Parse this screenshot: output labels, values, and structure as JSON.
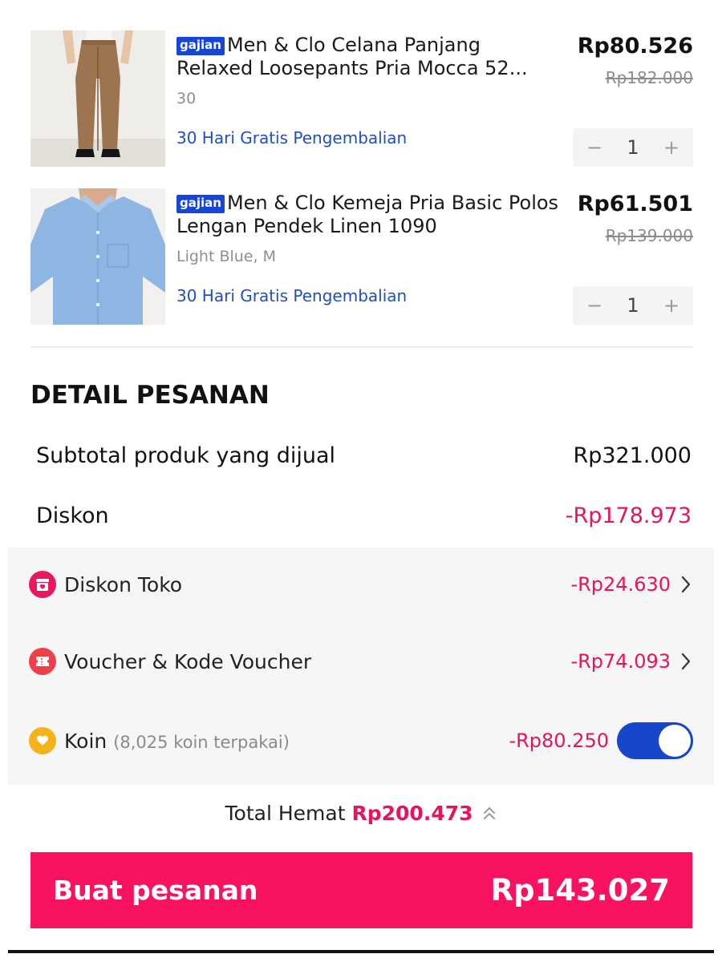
{
  "products": [
    {
      "badge": "gajian",
      "name": "Men & Clo Celana Panjang Relaxed Loosepants Pria Mocca 52...",
      "variant": "30",
      "return_text": "30 Hari Gratis Pengembalian",
      "price": "Rp80.526",
      "old_price": "Rp182.000",
      "qty_minus": "−",
      "qty": "1",
      "qty_plus": "+"
    },
    {
      "badge": "gajian",
      "name": "Men & Clo Kemeja Pria Basic Polos Lengan Pendek Linen 1090",
      "variant": "Light Blue, M",
      "return_text": "30 Hari Gratis Pengembalian",
      "price": "Rp61.501",
      "old_price": "Rp139.000",
      "qty_minus": "−",
      "qty": "1",
      "qty_plus": "+"
    }
  ],
  "detail": {
    "title": "DETAIL PESANAN",
    "subtotal_label": "Subtotal produk yang dijual",
    "subtotal_value": "Rp321.000",
    "diskon_label": "Diskon",
    "diskon_value": "-Rp178.973"
  },
  "discounts": {
    "toko_label": "Diskon Toko",
    "toko_value": "-Rp24.630",
    "voucher_label": "Voucher & Kode Voucher",
    "voucher_value": "-Rp74.093",
    "koin_label": "Koin",
    "koin_sub": "(8,025 koin terpakai)",
    "koin_value": "-Rp80.250",
    "koin_toggle_on": true
  },
  "summary": {
    "hemat_label": "Total Hemat",
    "hemat_value": "Rp200.473"
  },
  "cta": {
    "label": "Buat pesanan",
    "amount": "Rp143.027"
  },
  "colors": {
    "accent_pink": "#f9125e",
    "discount_text": "#e4145f",
    "link_blue": "#1f4fc1",
    "badge_blue": "#1646d9",
    "toggle_blue": "#1646c9"
  },
  "icons": {
    "toko": "store-icon",
    "voucher": "ticket-icon",
    "koin": "coin-heart-icon",
    "chevron": "chevron-right-icon",
    "hemat": "double-chevron-up-icon"
  }
}
